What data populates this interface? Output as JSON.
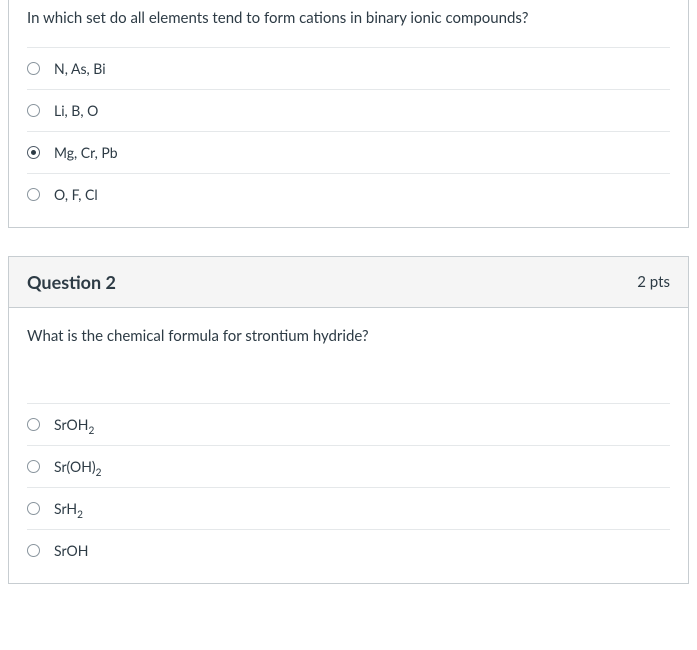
{
  "q1": {
    "text": "In which set do all elements tend to form cations in binary ionic compounds?",
    "options": [
      {
        "label": "N, As, Bi",
        "selected": false
      },
      {
        "label": "Li, B, O",
        "selected": false
      },
      {
        "label": "Mg, Cr, Pb",
        "selected": true
      },
      {
        "label": "O, F, Cl",
        "selected": false
      }
    ]
  },
  "q2": {
    "title": "Question 2",
    "points": "2 pts",
    "text": "What is the chemical formula for strontium hydride?",
    "options": [
      {
        "html": "SrOH<sub>2</sub>",
        "selected": false
      },
      {
        "html": "Sr(OH)<sub>2</sub>",
        "selected": false
      },
      {
        "html": "SrH<sub>2</sub>",
        "selected": false
      },
      {
        "html": "SrOH",
        "selected": false
      }
    ]
  }
}
